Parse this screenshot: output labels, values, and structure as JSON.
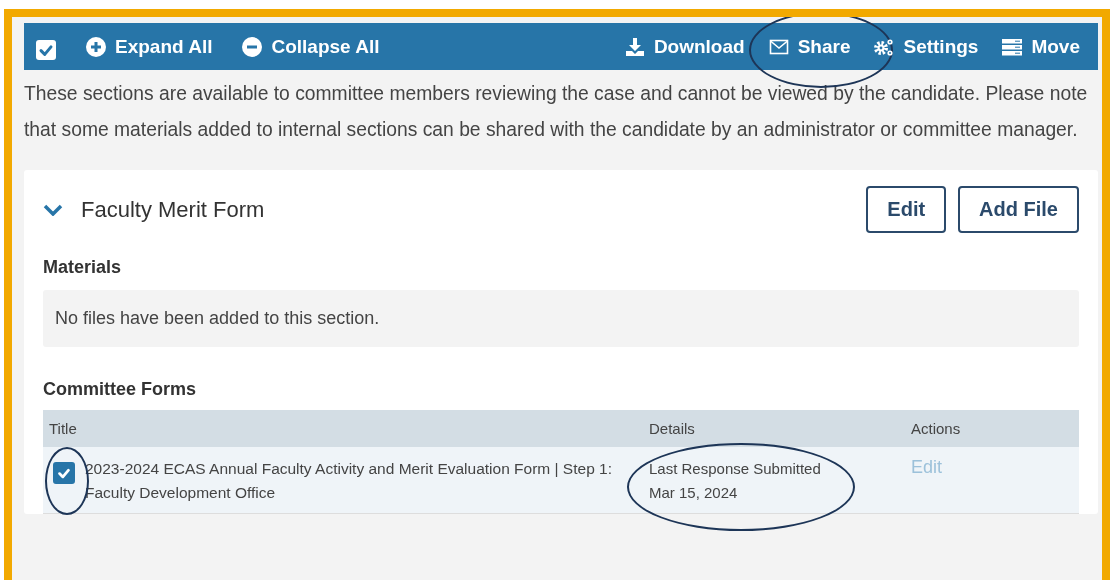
{
  "toolbar": {
    "select_all": {
      "checked": true
    },
    "actions": [
      {
        "kind": "expand",
        "label": "Expand All",
        "circled": false
      },
      {
        "kind": "collapse",
        "label": "Collapse All",
        "circled": false
      },
      {
        "kind": "download",
        "label": "Download",
        "circled": false
      },
      {
        "kind": "share",
        "label": "Share",
        "circled": true
      },
      {
        "kind": "settings",
        "label": "Settings",
        "circled": false
      },
      {
        "kind": "move",
        "label": "Move",
        "circled": false
      }
    ]
  },
  "notice": "These sections are available to committee members reviewing the case and cannot be viewed by the candidate. Please note that some materials added to internal sections can be shared with the candidate by an administrator or committee manager.",
  "section": {
    "title": "Faculty Merit Form",
    "expanded": true,
    "buttons": [
      "Edit",
      "Add File"
    ],
    "materials": {
      "heading": "Materials",
      "empty_text": "No files have been added to this section."
    },
    "committee_forms": {
      "heading": "Committee Forms",
      "columns": [
        "Title",
        "Details",
        "Actions"
      ],
      "rows": [
        {
          "checked": true,
          "checkbox_circled": true,
          "title": "2023-2024 ECAS Annual Faculty Activity and Merit Evaluation Form | Step 1: Faculty Development Office",
          "details": [
            "Last Response Submitted",
            "Mar 15, 2024"
          ],
          "details_circled": true,
          "action": "Edit"
        }
      ]
    }
  }
}
